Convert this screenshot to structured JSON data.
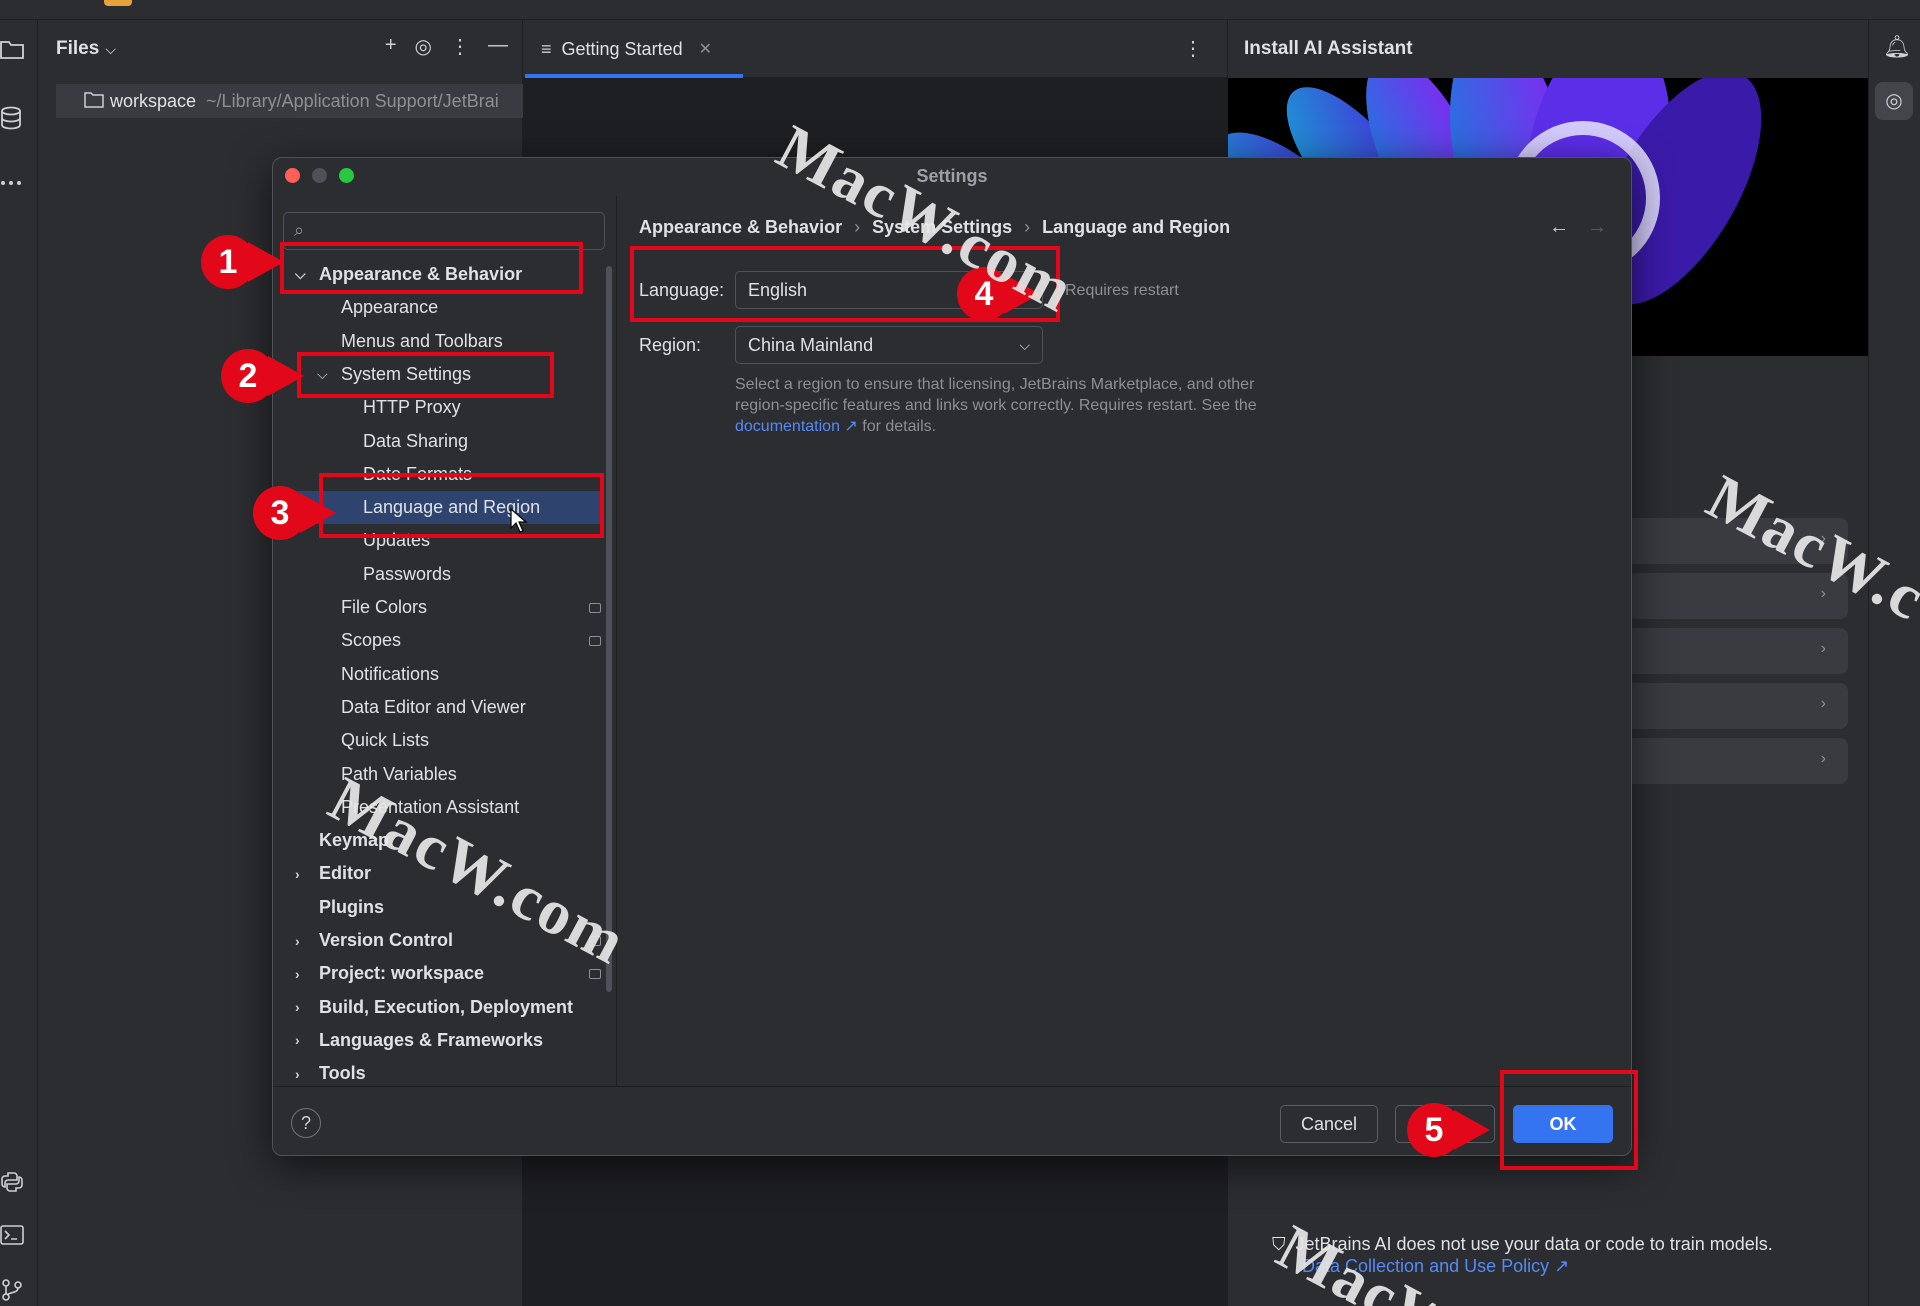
{
  "files_panel": {
    "title": "Files",
    "root_name": "workspace",
    "root_path": "~/Library/Application Support/JetBrai"
  },
  "editor": {
    "tab_label": "Getting Started"
  },
  "right_panel": {
    "title": "Install AI Assistant",
    "notice": "JetBrains AI does not use your data or code to train models.",
    "policy_link": "Data Collection and Use Policy ↗"
  },
  "dialog": {
    "title": "Settings",
    "search_placeholder": "",
    "tree": [
      {
        "label": "Appearance & Behavior",
        "bold": true,
        "arrow": "down",
        "indent": 0
      },
      {
        "label": "Appearance",
        "indent": 1
      },
      {
        "label": "Menus and Toolbars",
        "indent": 1
      },
      {
        "label": "System Settings",
        "arrow": "down",
        "indent": 1
      },
      {
        "label": "HTTP Proxy",
        "indent": 2
      },
      {
        "label": "Data Sharing",
        "indent": 2
      },
      {
        "label": "Date Formats",
        "indent": 2
      },
      {
        "label": "Language and Region",
        "indent": 2,
        "selected": true
      },
      {
        "label": "Updates",
        "indent": 2
      },
      {
        "label": "Passwords",
        "indent": 2
      },
      {
        "label": "File Colors",
        "indent": 1,
        "badge": true
      },
      {
        "label": "Scopes",
        "indent": 1,
        "badge": true
      },
      {
        "label": "Notifications",
        "indent": 1
      },
      {
        "label": "Data Editor and Viewer",
        "indent": 1
      },
      {
        "label": "Quick Lists",
        "indent": 1
      },
      {
        "label": "Path Variables",
        "indent": 1
      },
      {
        "label": "Presentation Assistant",
        "indent": 1
      },
      {
        "label": "Keymap",
        "bold": true,
        "indent": 0
      },
      {
        "label": "Editor",
        "bold": true,
        "arrow": "right",
        "indent": 0
      },
      {
        "label": "Plugins",
        "bold": true,
        "indent": 0
      },
      {
        "label": "Version Control",
        "bold": true,
        "arrow": "right",
        "indent": 0,
        "badge": true
      },
      {
        "label": "Project: workspace",
        "bold": true,
        "arrow": "right",
        "indent": 0,
        "badge": true
      },
      {
        "label": "Build, Execution, Deployment",
        "bold": true,
        "arrow": "right",
        "indent": 0
      },
      {
        "label": "Languages & Frameworks",
        "bold": true,
        "arrow": "right",
        "indent": 0
      },
      {
        "label": "Tools",
        "bold": true,
        "arrow": "right",
        "indent": 0
      }
    ],
    "breadcrumb": [
      "Appearance & Behavior",
      "System Settings",
      "Language and Region"
    ],
    "language_label": "Language:",
    "language_value": "English",
    "requires_restart": "Requires restart",
    "region_label": "Region:",
    "region_value": "China Mainland",
    "region_desc_pre": "Select a region to ensure that licensing, JetBrains Marketplace, and other region-specific features and links work correctly. Requires restart. See the",
    "region_desc_link": "documentation ↗",
    "region_desc_post": "for details.",
    "cancel_label": "Cancel",
    "ok_label": "OK",
    "help_label": "?"
  },
  "annotations": [
    "1",
    "2",
    "3",
    "4",
    "5"
  ],
  "watermarks": [
    "MacW.com",
    "MacW.com",
    "MacW.com",
    "MacW.c",
    "MacW"
  ],
  "colors": {
    "accent": "#3574f0",
    "annotation_red": "#e3071a",
    "selection": "#2e436e",
    "link": "#548af7"
  }
}
